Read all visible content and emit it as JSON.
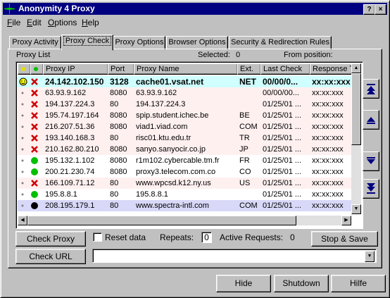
{
  "window": {
    "title": "Anonymity 4 Proxy",
    "controls": [
      "?",
      "×"
    ]
  },
  "menu": [
    {
      "label": "File",
      "underline": "F"
    },
    {
      "label": "Edit",
      "underline": "E"
    },
    {
      "label": "Options",
      "underline": "O"
    },
    {
      "label": "Help",
      "underline": "H"
    }
  ],
  "tabs": [
    "Proxy Activity",
    "Proxy Check",
    "Proxy Options",
    "Browser Options",
    "Security & Redirection Rules"
  ],
  "active_tab": "Proxy Check",
  "proxy_list": {
    "title": "Proxy List",
    "selected_label": "Selected:",
    "selected_value": "0",
    "from_position_label": "From position:",
    "columns": [
      "",
      "",
      "Proxy IP",
      "Port",
      "Proxy Name",
      "Ext.",
      "Last Check",
      "Response T"
    ],
    "rows": [
      {
        "status": "smiley",
        "mark": "x",
        "ip": "24.142.102.150",
        "port": "3128",
        "name": "cache01.vsat.net",
        "ext": "NET",
        "last_check": "00/00/0...",
        "response": "xx:xx:xxx",
        "style": "highlight"
      },
      {
        "status": "dot",
        "mark": "x",
        "ip": "63.93.9.162",
        "port": "8080",
        "name": "63.93.9.162",
        "ext": "",
        "last_check": "00/00/00...",
        "response": "xx:xx:xxx",
        "style": "pink"
      },
      {
        "status": "dot",
        "mark": "x",
        "ip": "194.137.224.3",
        "port": "80",
        "name": "194.137.224.3",
        "ext": "",
        "last_check": "01/25/01 ...",
        "response": "xx:xx:xxx",
        "style": "pink"
      },
      {
        "status": "dot",
        "mark": "x",
        "ip": "195.74.197.164",
        "port": "8080",
        "name": "spip.student.ichec.be",
        "ext": "BE",
        "last_check": "01/25/01 ...",
        "response": "xx:xx:xxx",
        "style": "pink"
      },
      {
        "status": "dot",
        "mark": "x",
        "ip": "216.207.51.36",
        "port": "8080",
        "name": "viad1.viad.com",
        "ext": "COM",
        "last_check": "01/25/01 ...",
        "response": "xx:xx:xxx",
        "style": "pink"
      },
      {
        "status": "dot",
        "mark": "x",
        "ip": "193.140.168.3",
        "port": "80",
        "name": "risc01.ktu.edu.tr",
        "ext": "TR",
        "last_check": "01/25/01 ...",
        "response": "xx:xx:xxx",
        "style": "pink"
      },
      {
        "status": "dot",
        "mark": "x",
        "ip": "210.162.80.210",
        "port": "8080",
        "name": "sanyo.sanyocir.co.jp",
        "ext": "JP",
        "last_check": "01/25/01 ...",
        "response": "xx:xx:xxx",
        "style": "pink"
      },
      {
        "status": "dot",
        "mark": "green",
        "ip": "195.132.1.102",
        "port": "8080",
        "name": "r1m102.cybercable.tm.fr",
        "ext": "FR",
        "last_check": "01/25/01 ...",
        "response": "xx:xx:xxx",
        "style": "normal"
      },
      {
        "status": "dot",
        "mark": "green",
        "ip": "200.21.230.74",
        "port": "8080",
        "name": "proxy3.telecom.com.co",
        "ext": "CO",
        "last_check": "01/25/01 ...",
        "response": "xx:xx:xxx",
        "style": "normal"
      },
      {
        "status": "dot",
        "mark": "x",
        "ip": "166.109.71.12",
        "port": "80",
        "name": "www.wpcsd.k12.ny.us",
        "ext": "US",
        "last_check": "01/25/01 ...",
        "response": "xx:xx:xxx",
        "style": "pink"
      },
      {
        "status": "dot",
        "mark": "green",
        "ip": "195.8.8.1",
        "port": "80",
        "name": "195.8.8.1",
        "ext": "",
        "last_check": "01/25/01 ...",
        "response": "xx:xx:xxx",
        "style": "normal"
      },
      {
        "status": "dot",
        "mark": "black",
        "ip": "208.195.179.1",
        "port": "80",
        "name": "www.spectra-intl.com",
        "ext": "COM",
        "last_check": "01/25/01 ...",
        "response": "xx:xx:xxx",
        "style": "selected"
      }
    ]
  },
  "controls": {
    "check_proxy": "Check Proxy",
    "reset_data": "Reset data",
    "reset_checked": false,
    "repeats_label": "Repeats:",
    "repeats_value": "0",
    "active_requests_label": "Active Requests:",
    "active_requests_value": "0",
    "stop_save": "Stop & Save",
    "check_url": "Check URL",
    "url_value": ""
  },
  "bottom_buttons": [
    "Hide",
    "Shutdown",
    "Hilfe"
  ],
  "colors": {
    "title_bar": "#000080",
    "highlight_row": "#cfffff",
    "pink_row": "#fff0f0",
    "selected_row": "#d8d8f8",
    "error_mark": "#d00000",
    "ok_mark": "#00c000",
    "nav_arrow": "#000080"
  }
}
